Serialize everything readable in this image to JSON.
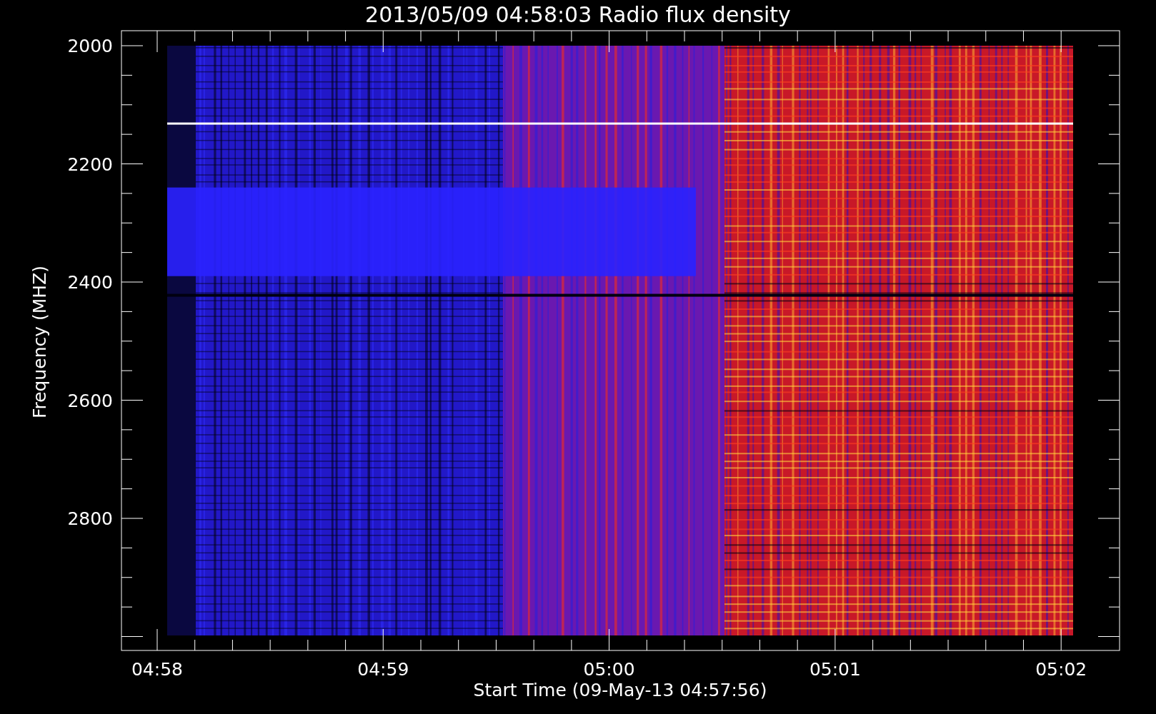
{
  "title": "2013/05/09 04:58:03 Radio flux density",
  "y_axis": {
    "label": "Frequency (MHZ)",
    "ticks": [
      "2000",
      "2200",
      "2400",
      "2600",
      "2800"
    ]
  },
  "x_axis": {
    "label": "Start Time (09-May-13 04:57:56)",
    "ticks": [
      "04:58",
      "04:59",
      "05:00",
      "05:01",
      "05:02"
    ]
  }
}
